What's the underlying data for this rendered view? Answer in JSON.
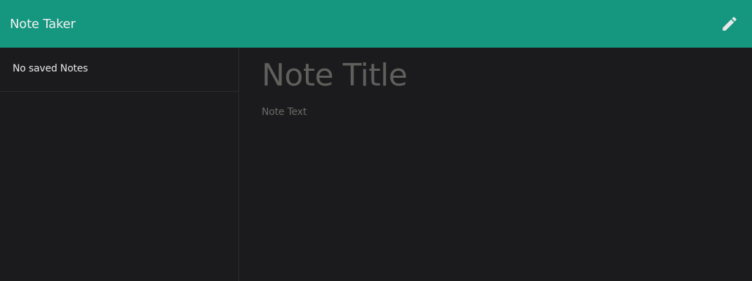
{
  "navbar": {
    "brand": "Note Taker",
    "new_note_icon": "pencil-icon",
    "background_color": "#14967f"
  },
  "sidebar": {
    "items": [
      {
        "label": "No saved Notes"
      }
    ]
  },
  "editor": {
    "title_value": "",
    "title_placeholder": "Note Title",
    "text_value": "",
    "text_placeholder": "Note Text"
  },
  "colors": {
    "accent": "#14967f",
    "background": "#1b1b1d",
    "placeholder": "#5f5f5c"
  }
}
